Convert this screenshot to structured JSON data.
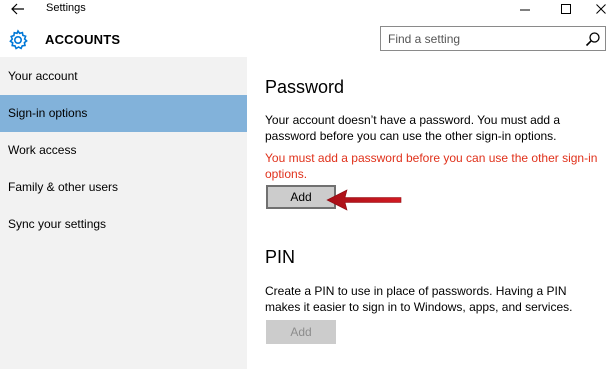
{
  "window": {
    "title": "Settings"
  },
  "header": {
    "title": "ACCOUNTS",
    "search_placeholder": "Find a setting"
  },
  "sidebar": {
    "items": [
      {
        "label": "Your account",
        "active": false
      },
      {
        "label": "Sign-in options",
        "active": true
      },
      {
        "label": "Work access",
        "active": false
      },
      {
        "label": "Family & other users",
        "active": false
      },
      {
        "label": "Sync your settings",
        "active": false
      }
    ]
  },
  "password": {
    "title": "Password",
    "description": "Your account doesn’t have a password. You must add a password before you can use the other sign-in options.",
    "warning": "You must add a password before you can use the other sign-in options.",
    "add_label": "Add"
  },
  "pin": {
    "title": "PIN",
    "description": "Create a PIN to use in place of passwords. Having a PIN makes it easier to sign in to Windows, apps, and services.",
    "add_label": "Add"
  },
  "colors": {
    "accent": "#0078d7",
    "sidebar_selected": "#82b2da",
    "warning": "#e0311b",
    "annotation_arrow": "#c0121b"
  }
}
